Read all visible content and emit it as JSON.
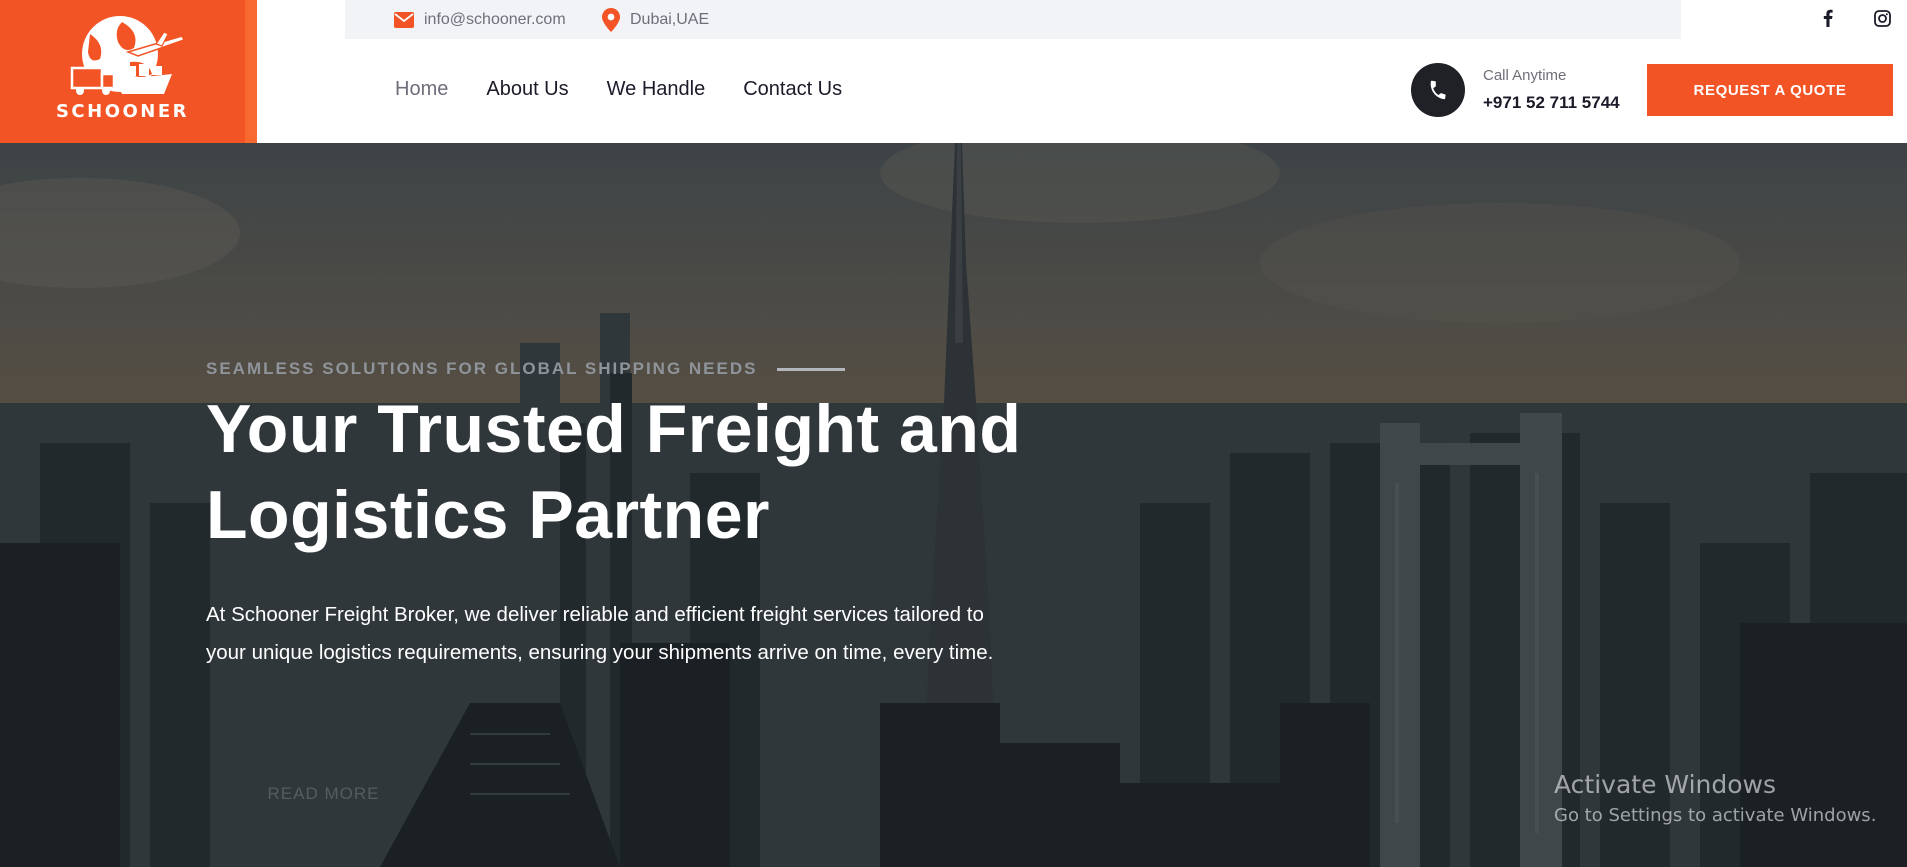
{
  "brand": {
    "name": "SCHOONER",
    "color": "#f35425"
  },
  "topbar": {
    "email": "info@schooner.com",
    "location": "Dubai,UAE",
    "icons": [
      "envelope-icon",
      "map-pin-icon"
    ]
  },
  "social": {
    "icons": [
      "facebook-icon",
      "instagram-icon"
    ]
  },
  "nav": {
    "items": [
      {
        "label": "Home",
        "active": true
      },
      {
        "label": "About Us"
      },
      {
        "label": "We Handle"
      },
      {
        "label": "Contact Us"
      }
    ]
  },
  "contact": {
    "label": "Call Anytime",
    "phone": "+971 52 711 5744",
    "icon": "phone-icon"
  },
  "cta": {
    "quote_label": "REQUEST A QUOTE"
  },
  "hero": {
    "eyebrow": "SEAMLESS SOLUTIONS FOR GLOBAL SHIPPING NEEDS",
    "title_line1": "Your Trusted Freight and",
    "title_line2": "Logistics Partner",
    "description": "At Schooner Freight Broker, we deliver reliable and efficient freight services tailored to your unique logistics requirements, ensuring your shipments arrive on time, every time.",
    "button_label": "READ MORE"
  },
  "watermark": {
    "title": "Activate Windows",
    "subtitle": "Go to Settings to activate Windows."
  }
}
